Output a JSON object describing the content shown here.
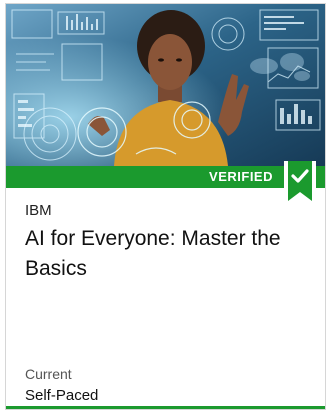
{
  "card": {
    "badge": "VERIFIED",
    "organization": "IBM",
    "title": "AI for Everyone: Master the Basics",
    "status_label": "Current",
    "pacing": "Self-Paced"
  },
  "colors": {
    "accent_green": "#1b9a2e",
    "hero_background": "#1d4a6b"
  },
  "icons": {
    "badge_icon": "checkmark-ribbon-icon"
  }
}
